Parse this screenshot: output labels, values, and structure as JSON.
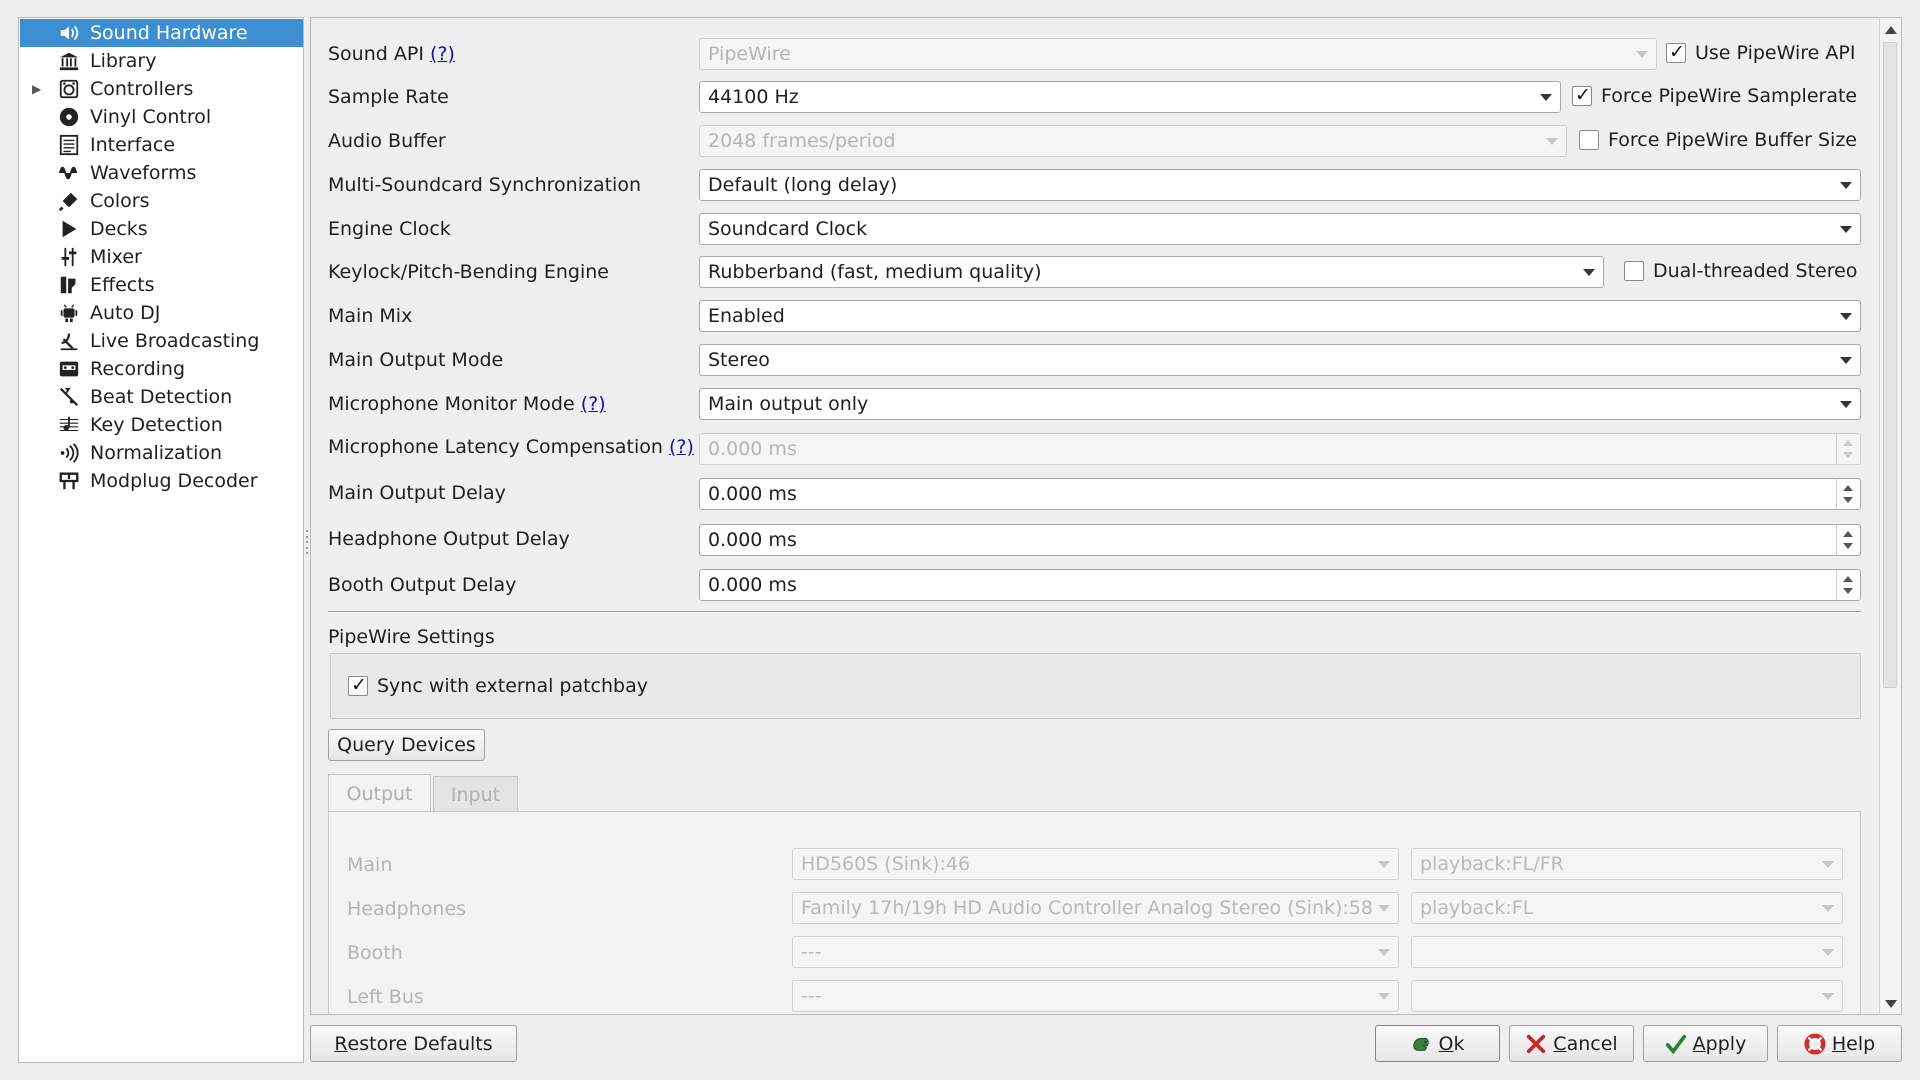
{
  "sidebar": {
    "items": [
      {
        "label": "Sound Hardware",
        "icon": "speaker-icon",
        "selected": true
      },
      {
        "label": "Library",
        "icon": "library-icon"
      },
      {
        "label": "Controllers",
        "icon": "controller-icon",
        "expandable": true
      },
      {
        "label": "Vinyl Control",
        "icon": "vinyl-icon"
      },
      {
        "label": "Interface",
        "icon": "interface-icon"
      },
      {
        "label": "Waveforms",
        "icon": "waveform-icon"
      },
      {
        "label": "Colors",
        "icon": "colors-icon"
      },
      {
        "label": "Decks",
        "icon": "play-icon"
      },
      {
        "label": "Mixer",
        "icon": "mixer-icon"
      },
      {
        "label": "Effects",
        "icon": "effects-icon"
      },
      {
        "label": "Auto DJ",
        "icon": "autodj-icon"
      },
      {
        "label": "Live Broadcasting",
        "icon": "broadcast-icon"
      },
      {
        "label": "Recording",
        "icon": "recording-icon"
      },
      {
        "label": "Beat Detection",
        "icon": "beat-detection-icon"
      },
      {
        "label": "Key Detection",
        "icon": "key-detection-icon"
      },
      {
        "label": "Normalization",
        "icon": "normalization-icon"
      },
      {
        "label": "Modplug Decoder",
        "icon": "modplug-icon"
      }
    ]
  },
  "settings": {
    "sound_api": {
      "label": "Sound API",
      "help": "(?)",
      "value": "PipeWire",
      "check_label": "Use PipeWire API",
      "checked": true
    },
    "sample_rate": {
      "label": "Sample Rate",
      "value": "44100 Hz",
      "check_label": "Force PipeWire Samplerate",
      "checked": true
    },
    "audio_buffer": {
      "label": "Audio Buffer",
      "value": "2048 frames/period",
      "check_label": "Force PipeWire Buffer Size",
      "checked": false
    },
    "multi_sync": {
      "label": "Multi-Soundcard Synchronization",
      "value": "Default (long delay)"
    },
    "engine_clock": {
      "label": "Engine Clock",
      "value": "Soundcard Clock"
    },
    "keylock": {
      "label": "Keylock/Pitch-Bending Engine",
      "value": "Rubberband (fast, medium quality)",
      "check_label": "Dual-threaded Stereo",
      "checked": false
    },
    "main_mix": {
      "label": "Main Mix",
      "value": "Enabled"
    },
    "main_output_mode": {
      "label": "Main Output Mode",
      "value": "Stereo"
    },
    "mic_monitor_mode": {
      "label": "Microphone Monitor Mode",
      "help": "(?)",
      "value": "Main output only"
    },
    "mic_latency": {
      "label": "Microphone Latency Compensation",
      "help": "(?)",
      "value": "0.000 ms"
    },
    "main_output_delay": {
      "label": "Main Output Delay",
      "value": "0.000 ms"
    },
    "headphone_output_delay": {
      "label": "Headphone Output Delay",
      "value": "0.000 ms"
    },
    "booth_output_delay": {
      "label": "Booth Output Delay",
      "value": "0.000 ms"
    }
  },
  "pipewire": {
    "title": "PipeWire Settings",
    "sync_label": "Sync with external patchbay",
    "sync_checked": true
  },
  "query_devices_label": "Query Devices",
  "tabs": {
    "output": "Output",
    "input": "Input",
    "active": "Output"
  },
  "outputs": [
    {
      "label": "Main",
      "device": "HD560S (Sink):46",
      "channels": "playback:FL/FR"
    },
    {
      "label": "Headphones",
      "device": "Family 17h/19h HD Audio Controller Analog Stereo (Sink):58",
      "channels": "playback:FL"
    },
    {
      "label": "Booth",
      "device": "---",
      "channels": ""
    },
    {
      "label": "Left Bus",
      "device": "---",
      "channels": ""
    }
  ],
  "footer": {
    "restore_defaults": {
      "mnemonic": "R",
      "rest": "estore Defaults"
    },
    "ok": {
      "mnemonic": "O",
      "rest": "k"
    },
    "cancel": {
      "mnemonic": "C",
      "rest": "ancel"
    },
    "apply": {
      "mnemonic": "A",
      "rest": "pply"
    },
    "help": {
      "mnemonic": "H",
      "rest": "elp"
    }
  },
  "colors": {
    "selection": "#3d8fd2",
    "link": "#1a0dab",
    "cancel_red": "#c62828",
    "apply_green": "#2e7d32"
  }
}
